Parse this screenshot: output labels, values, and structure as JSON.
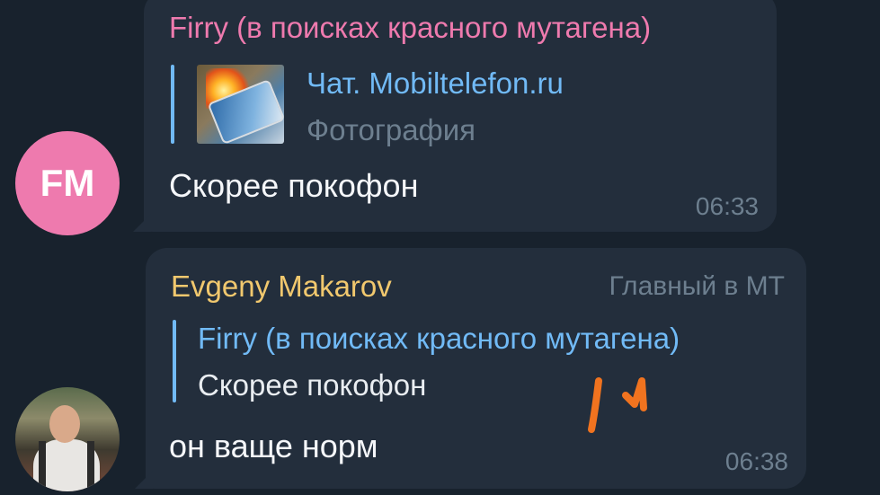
{
  "colors": {
    "background": "#18222d",
    "bubble": "#232e3c",
    "sender_pink": "#ee7aae",
    "sender_yellow": "#f1c86e",
    "reply_link": "#71baf6",
    "muted": "#6d7f8f",
    "avatar_fm_bg": "#ee7aae",
    "scribble": "#f0731f"
  },
  "messages": [
    {
      "sender": "Firry (в поисках красного мутагена)",
      "reply": {
        "title": "Чат. Mobiltelefon.ru",
        "text": "Фотография",
        "thumbnail": "photo-thumbnail"
      },
      "text": "Скорее покофон",
      "time": "06:33",
      "avatar": {
        "initials": "FM"
      }
    },
    {
      "sender": "Evgeny Makarov",
      "admin_label": "Главный в МТ",
      "reply": {
        "title": "Firry (в поисках красного мутагена)",
        "text": "Скорее покофон"
      },
      "text": "он ваще норм",
      "time": "06:38",
      "avatar": {
        "icon": "user-photo-avatar"
      }
    }
  ]
}
